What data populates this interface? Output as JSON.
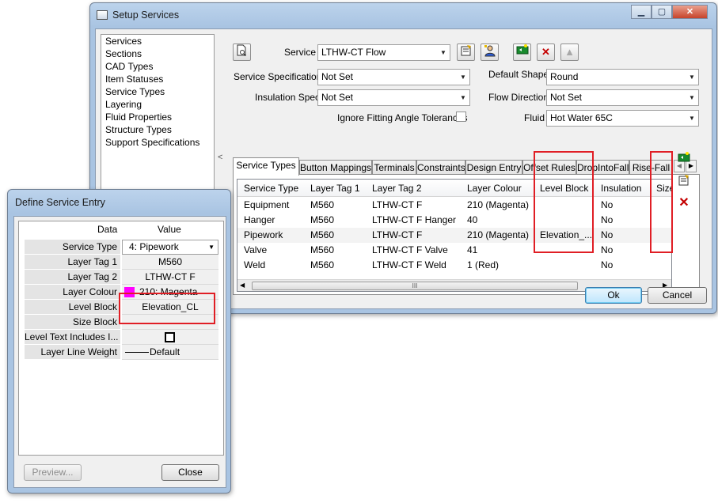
{
  "setup_window": {
    "title": "Setup Services",
    "sidebar_items": [
      "Services",
      "Sections",
      "CAD Types",
      "Item Statuses",
      "Service Types",
      "Layering",
      "Fluid Properties",
      "Structure Types",
      "Support Specifications"
    ],
    "service_label": "Service",
    "service_value": "LTHW-CT Flow",
    "service_spec_label": "Service Specification",
    "service_spec_value": "Not Set",
    "default_shape_label": "Default Shape",
    "default_shape_value": "Round",
    "insulation_spec_label": "Insulation Spec",
    "insulation_spec_value": "Not Set",
    "flow_direction_label": "Flow Direction",
    "flow_direction_value": "Not Set",
    "ignore_fitting_label": "Ignore Fitting Angle Tolerances",
    "fluid_label": "Fluid",
    "fluid_value": "Hot Water 65C",
    "tabs": [
      "Service Types",
      "Button Mappings",
      "Terminals",
      "Constraints",
      "Design Entry",
      "Offset Rules",
      "DropIntoFall",
      "Rise-Fall"
    ],
    "table_headers": [
      "Service Type",
      "Layer Tag 1",
      "Layer Tag 2",
      "Layer Colour",
      "Level Block",
      "Insulation",
      "Size"
    ],
    "table_rows": [
      [
        "Equipment",
        "M560",
        "LTHW-CT F",
        "210 (Magenta)",
        "",
        "No",
        ""
      ],
      [
        "Hanger",
        "M560",
        "LTHW-CT F Hanger",
        "40",
        "",
        "No",
        ""
      ],
      [
        "Pipework",
        "M560",
        "LTHW-CT F",
        "210 (Magenta)",
        "Elevation_...",
        "No",
        ""
      ],
      [
        "Valve",
        "M560",
        "LTHW-CT F Valve",
        "41",
        "",
        "No",
        ""
      ],
      [
        "Weld",
        "M560",
        "LTHW-CT F Weld",
        "1 (Red)",
        "",
        "No",
        ""
      ]
    ],
    "scroll_grip": "III",
    "splitter_arrow": "<",
    "ok_label": "Ok",
    "cancel_label": "Cancel"
  },
  "define_window": {
    "title": "Define Service Entry",
    "col_data": "Data",
    "col_value": "Value",
    "rows": [
      {
        "name": "Service Type",
        "value": "4: Pipework"
      },
      {
        "name": "Layer Tag 1",
        "value": "M560"
      },
      {
        "name": "Layer Tag 2",
        "value": "LTHW-CT F"
      },
      {
        "name": "Layer Colour",
        "value": "210: Magenta"
      },
      {
        "name": "Level Block",
        "value": "Elevation_CL"
      },
      {
        "name": "Size Block",
        "value": ""
      },
      {
        "name": "Level Text Includes I...",
        "value": ""
      },
      {
        "name": "Layer Line Weight",
        "value": "Default"
      }
    ],
    "preview_label": "Preview...",
    "close_label": "Close"
  },
  "colors": {
    "highlight_red": "#e01e25",
    "magenta_swatch": "#ff00ff",
    "title_bar": "#a9c4e2"
  }
}
